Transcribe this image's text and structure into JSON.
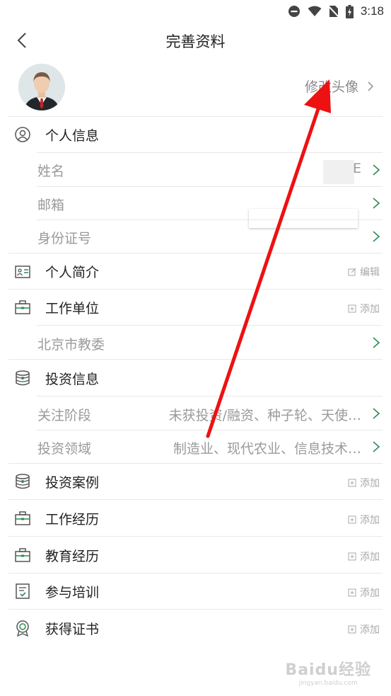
{
  "status_bar": {
    "time": "3:18"
  },
  "header": {
    "title": "完善资料"
  },
  "avatar_section": {
    "edit_label": "修改头像"
  },
  "personal_info": {
    "title": "个人信息",
    "fields": [
      {
        "label": "姓名",
        "value": "E"
      },
      {
        "label": "邮箱",
        "value": ""
      },
      {
        "label": "身份证号",
        "value": ""
      }
    ]
  },
  "profile_intro": {
    "title": "个人简介",
    "action": "编辑"
  },
  "work_unit": {
    "title": "工作单位",
    "action": "添加",
    "item": "北京市教委"
  },
  "investment_info": {
    "title": "投资信息",
    "fields": [
      {
        "label": "关注阶段",
        "value": "未获投资/融资、种子轮、天使…"
      },
      {
        "label": "投资领域",
        "value": "制造业、现代农业、信息技术…"
      }
    ]
  },
  "investment_cases": {
    "title": "投资案例",
    "action": "添加"
  },
  "work_experience": {
    "title": "工作经历",
    "action": "添加"
  },
  "education": {
    "title": "教育经历",
    "action": "添加"
  },
  "training": {
    "title": "参与培训",
    "action": "添加"
  },
  "certificates": {
    "title": "获得证书",
    "action": "添加"
  },
  "watermark": {
    "main": "Baidu经验",
    "sub": "jingyan.baidu.com"
  },
  "colors": {
    "accent": "#2e8b57",
    "annotation": "#ee1111"
  }
}
